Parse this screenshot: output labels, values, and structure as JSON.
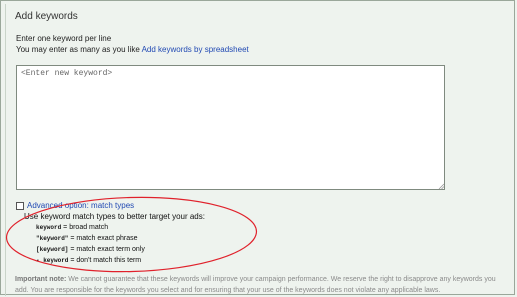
{
  "header": {
    "title": "Add keywords"
  },
  "instructions": {
    "line1": "Enter one keyword per line",
    "line2_prefix": "You may enter as many as you like",
    "spreadsheet_link": "Add keywords by spreadsheet"
  },
  "keyword_input": {
    "placeholder": "<Enter new keyword>",
    "value": ""
  },
  "advanced": {
    "checked": false,
    "link_label": "Advanced option: match types",
    "description": "Use keyword match types to better target your ads:",
    "match_types": [
      {
        "keyword": "keyword",
        "description": "= broad match"
      },
      {
        "keyword": "\"keyword\"",
        "description": "= match exact phrase"
      },
      {
        "keyword": "[keyword]",
        "description": "= match exact term only"
      },
      {
        "keyword": "- keyword",
        "description": "= don't match this term"
      }
    ]
  },
  "important_note": {
    "label": "Important note:",
    "text": "We cannot guarantee that these keywords will improve your campaign performance. We reserve the right to disapprove any keywords you add. You are responsible for the keywords you select and for ensuring that your use of the keywords does not violate any applicable laws."
  },
  "colors": {
    "background": "#eef3ee",
    "link": "#2149b3",
    "annotation_ellipse": "#e0212b"
  }
}
